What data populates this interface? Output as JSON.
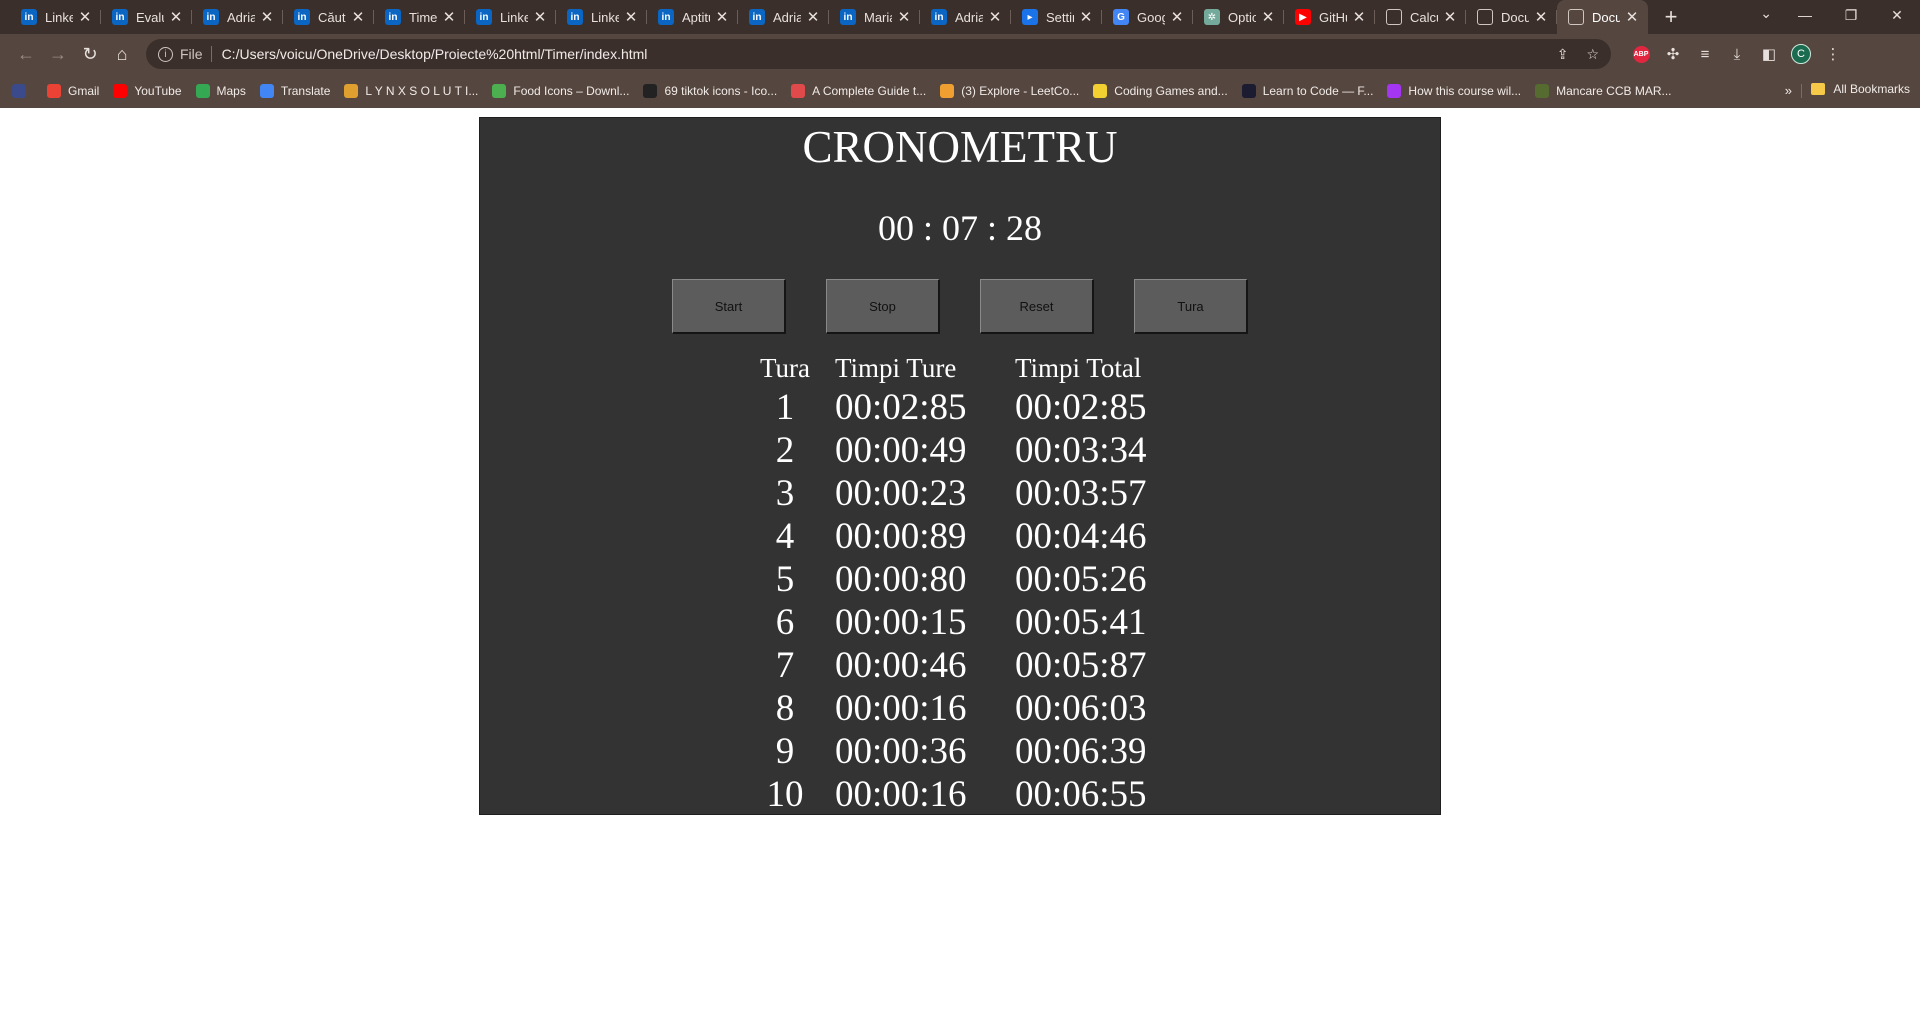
{
  "browser": {
    "tabs": [
      {
        "title": "Linkedin",
        "icon": "linkedin-icon",
        "active": false
      },
      {
        "title": "Evaluare",
        "icon": "linkedin-icon",
        "active": false
      },
      {
        "title": "Adrian",
        "icon": "linkedin-icon",
        "active": false
      },
      {
        "title": "Căutare",
        "icon": "linkedin-icon",
        "active": false
      },
      {
        "title": "Timeline",
        "icon": "linkedin-icon",
        "active": false
      },
      {
        "title": "Linkedin",
        "icon": "linkedin-icon",
        "active": false
      },
      {
        "title": "Linkedin",
        "icon": "linkedin-icon",
        "active": false
      },
      {
        "title": "Aptitudini",
        "icon": "linkedin-icon",
        "active": false
      },
      {
        "title": "Adrian",
        "icon": "linkedin-icon",
        "active": false
      },
      {
        "title": "Mariana",
        "icon": "linkedin-icon",
        "active": false
      },
      {
        "title": "Adrian",
        "icon": "linkedin-icon",
        "active": false
      },
      {
        "title": "Settings",
        "icon": "settings-icon",
        "active": false
      },
      {
        "title": "Google",
        "icon": "google-translate-icon",
        "active": false
      },
      {
        "title": "Options",
        "icon": "chatgpt-icon",
        "active": false
      },
      {
        "title": "GitHub",
        "icon": "youtube-icon",
        "active": false
      },
      {
        "title": "Calculator",
        "icon": "globe-icon",
        "active": false
      },
      {
        "title": "Document",
        "icon": "globe-icon",
        "active": false
      },
      {
        "title": "Document",
        "icon": "globe-icon",
        "active": true
      }
    ],
    "new_tab_symbol": "+",
    "url_scheme": "File",
    "url": "C:/Users/voicu/OneDrive/Desktop/Proiecte%20html/Timer/index.html",
    "profile_initial": "C",
    "abp_label": "ABP",
    "bookmarks": [
      {
        "label": "",
        "icon": "fl-icon",
        "color": "#3a4a8a"
      },
      {
        "label": "Gmail",
        "icon": "gmail-icon",
        "color": "#ea4335"
      },
      {
        "label": "YouTube",
        "icon": "youtube-icon",
        "color": "#ff0000"
      },
      {
        "label": "Maps",
        "icon": "maps-icon",
        "color": "#34a853"
      },
      {
        "label": "Translate",
        "icon": "translate-icon",
        "color": "#4285f4"
      },
      {
        "label": "L Y N X S O L U T I...",
        "icon": "lynx-icon",
        "color": "#e0a030"
      },
      {
        "label": "Food Icons – Downl...",
        "icon": "flaticon-icon",
        "color": "#4caf50"
      },
      {
        "label": "69 tiktok icons - Ico...",
        "icon": "icons8-icon",
        "color": "#222222"
      },
      {
        "label": "A Complete Guide t...",
        "icon": "css-tricks-icon",
        "color": "#e04a4a"
      },
      {
        "label": "(3) Explore - LeetCo...",
        "icon": "leetcode-icon",
        "color": "#f0a030"
      },
      {
        "label": "Coding Games and...",
        "icon": "codingame-icon",
        "color": "#f2d031"
      },
      {
        "label": "Learn to Code — F...",
        "icon": "freecodecamp-icon",
        "color": "#1b1b32"
      },
      {
        "label": "How this course wil...",
        "icon": "udemy-icon",
        "color": "#a435f0"
      },
      {
        "label": "Mancare CCB MAR...",
        "icon": "food-icon",
        "color": "#556b2f"
      }
    ],
    "all_bookmarks_label": "All Bookmarks"
  },
  "timer": {
    "title": "CRONOMETRU",
    "display": "00 : 07 : 28",
    "buttons": {
      "start": "Start",
      "stop": "Stop",
      "reset": "Reset",
      "lap": "Tura"
    },
    "headers": {
      "lap": "Tura",
      "lap_time": "Timpi Ture",
      "total_time": "Timpi Total"
    },
    "laps": [
      {
        "n": "1",
        "lap": "00:02:85",
        "total": "00:02:85"
      },
      {
        "n": "2",
        "lap": "00:00:49",
        "total": "00:03:34"
      },
      {
        "n": "3",
        "lap": "00:00:23",
        "total": "00:03:57"
      },
      {
        "n": "4",
        "lap": "00:00:89",
        "total": "00:04:46"
      },
      {
        "n": "5",
        "lap": "00:00:80",
        "total": "00:05:26"
      },
      {
        "n": "6",
        "lap": "00:00:15",
        "total": "00:05:41"
      },
      {
        "n": "7",
        "lap": "00:00:46",
        "total": "00:05:87"
      },
      {
        "n": "8",
        "lap": "00:00:16",
        "total": "00:06:03"
      },
      {
        "n": "9",
        "lap": "00:00:36",
        "total": "00:06:39"
      },
      {
        "n": "10",
        "lap": "00:00:16",
        "total": "00:06:55"
      }
    ]
  },
  "colors": {
    "panel_bg": "#333333",
    "button_bg": "#5c5c5c",
    "browser_frame": "#3b2f2b",
    "browser_toolbar": "#55463f"
  }
}
